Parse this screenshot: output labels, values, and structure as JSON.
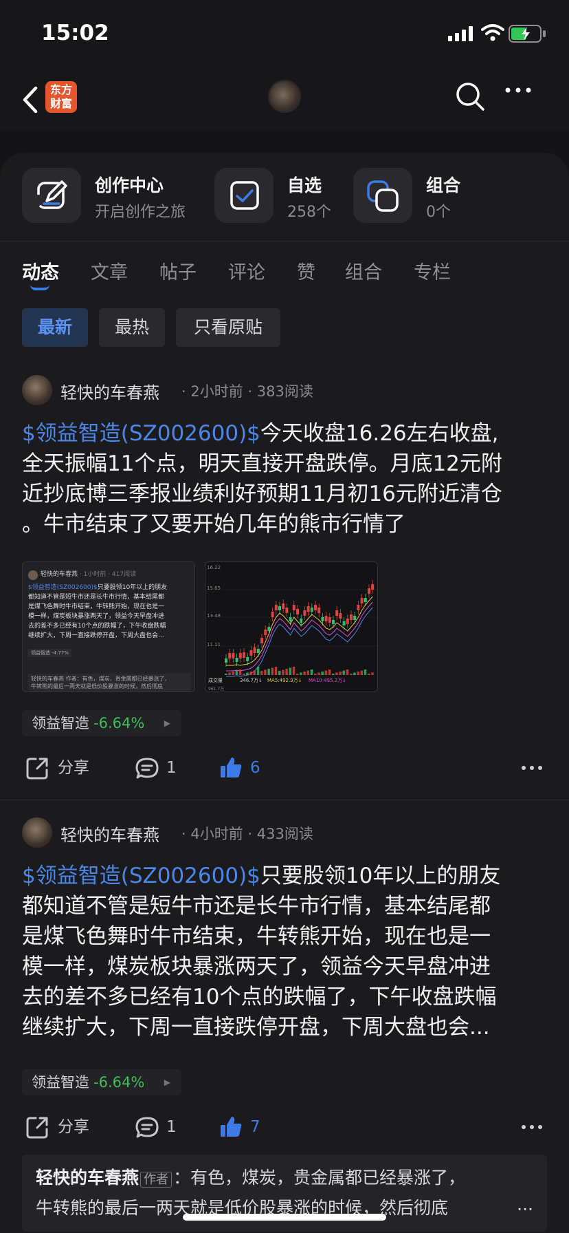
{
  "status": {
    "time": "15:02"
  },
  "nav": {
    "logo_line1": "东方",
    "logo_line2": "财富"
  },
  "quick": [
    {
      "title": "创作中心",
      "sub": "开启创作之旅"
    },
    {
      "title": "自选",
      "sub": "258个"
    },
    {
      "title": "组合",
      "sub": "0个"
    }
  ],
  "tabs": [
    "动态",
    "文章",
    "帖子",
    "评论",
    "赞",
    "组合",
    "专栏"
  ],
  "filters": [
    "最新",
    "最热",
    "只看原贴"
  ],
  "posts": [
    {
      "author": "轻快的车春燕",
      "meta": "· 2小时前 · 383阅读",
      "stock_link": "$领益智造(SZ002600)$",
      "text_l1": "今天收盘16.26左右收盘,",
      "text_l2": "全天振幅11个点，明天直接开盘跌停。月底12元附",
      "text_l3": "近抄底博三季报业绩利好预期11月初16元附近清仓",
      "text_l4": "。牛市结束了又要开始几年的熊市行情了",
      "tag_name": "领益智造",
      "tag_change": "-6.64%",
      "share": "分享",
      "comments": "1",
      "likes": "6",
      "thumb1": {
        "name": "轻快的车春燕",
        "meta": "· 1小时前 · 417阅读",
        "link": "$领益智造(SZ002600)$",
        "t1": "只要股领10年以上的朋友",
        "t2": "都知道不管是短牛市还是长牛市行情，基本结尾都",
        "t3": "是煤飞色舞时牛市结束，牛转熊开始，现在也是一",
        "t4": "模一样，煤炭板块暴涨两天了，领益今天早盘冲进",
        "t5": "去的差不多已经有10个点的跌幅了，下午收盘跌幅",
        "t6": "继续扩大，下周一直接跌停开盘，下周大盘也会...",
        "tag": "领益智造 -4.77%",
        "c1": "轻快的车春燕 作者：有色，煤炭，贵金属都已经暴涨了，",
        "c2": "牛转熊的最后一两天就是低价股暴涨的时候，然后彻底"
      },
      "thumb2": {
        "y_labels": [
          "16.22",
          "15.65",
          "13.48",
          "11.11"
        ],
        "vol": "成交量",
        "vol_val": "346.7万↓",
        "ma5": "MA5:492.9万↓",
        "ma10": "MA10:495.2万↓",
        "bottom": "961.7万"
      }
    },
    {
      "author": "轻快的车春燕",
      "meta": "· 4小时前 · 433阅读",
      "stock_link": "$领益智造(SZ002600)$",
      "text_l1": "只要股领10年以上的朋友",
      "text_l2": "都知道不管是短牛市还是长牛市行情，基本结尾都",
      "text_l3": "是煤飞色舞时牛市结束，牛转熊开始，现在也是一",
      "text_l4": "模一样，煤炭板块暴涨两天了，领益今天早盘冲进",
      "text_l5": "去的差不多已经有10个点的跌幅了，下午收盘跌幅",
      "text_l6": "继续扩大，下周一直接跌停开盘，下周大盘也会...",
      "tag_name": "领益智造",
      "tag_change": "-6.64%",
      "share": "分享",
      "comments": "1",
      "likes": "7"
    }
  ],
  "comment": {
    "user": "轻快的车春燕",
    "badge": "作者",
    "line1": "：有色，煤炭，贵金属都已经暴涨了，",
    "line2": "牛转熊的最后一两天就是低价股暴涨的时候，然后彻底",
    "more": "..."
  },
  "colors": {
    "accent": "#3d7be8",
    "down_green": "#3cbf5a",
    "brand": "#e8542c"
  }
}
